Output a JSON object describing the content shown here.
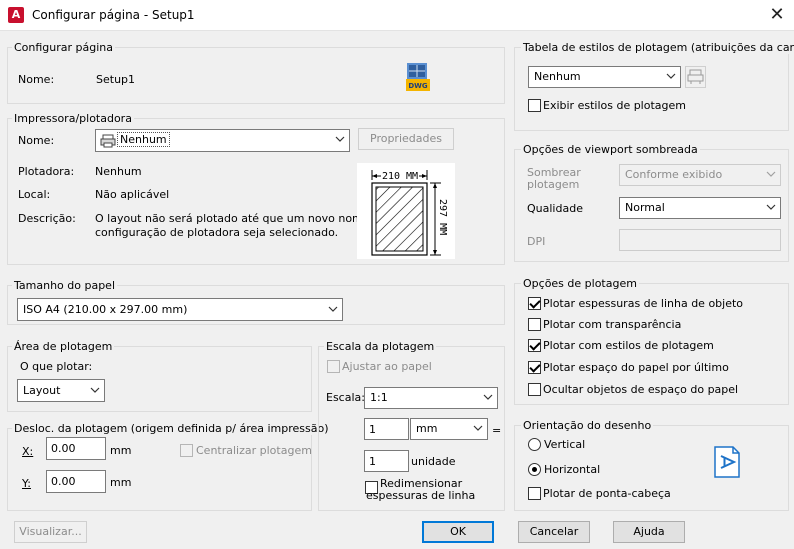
{
  "window": {
    "title": "Configurar página - Setup1",
    "app_icon_letter": "A",
    "close_glyph": "✕"
  },
  "page_setup": {
    "group_title": "Configurar página",
    "name_label": "Nome:",
    "name_value": "Setup1",
    "file_icon_text": "DWG"
  },
  "printer": {
    "group_title": "Impressora/plotadora",
    "name_label": "Nome:",
    "name_value": "Nenhum",
    "properties_button": "Propriedades",
    "plotter_label": "Plotadora:",
    "plotter_value": "Nenhum",
    "location_label": "Local:",
    "location_value": "Não aplicável",
    "description_label": "Descrição:",
    "description_line1": "O layout não será plotado até que um novo nome de",
    "description_line2": "configuração de plotadora seja selecionado.",
    "preview_width": "210 MM",
    "preview_height": "297 MM"
  },
  "paper_size": {
    "group_title": "Tamanho do papel",
    "value": "ISO A4 (210.00 x 297.00 mm)"
  },
  "plot_area": {
    "group_title": "Área de plotagem",
    "what_label": "O que plotar:",
    "what_value": "Layout"
  },
  "plot_offset": {
    "group_title": "Desloc. da plotagem (origem definida p/ área impressão)",
    "x_label": "X:",
    "x_value": "0.00",
    "x_unit": "mm",
    "y_label": "Y:",
    "y_value": "0.00",
    "y_unit": "mm",
    "center_label": "Centralizar plotagem"
  },
  "plot_scale": {
    "group_title": "Escala da plotagem",
    "fit_label": "Ajustar ao papel",
    "scale_label": "Escala:",
    "scale_value": "1:1",
    "value1": "1",
    "unit1": "mm",
    "equals": "=",
    "value2": "1",
    "unit2_label": "unidade",
    "scale_lineweights_line1": "Redimensionar",
    "scale_lineweights_line2": "espessuras de linha"
  },
  "plot_style_table": {
    "group_title": "Tabela de estilos de plotagem (atribuições da caneta)",
    "value": "Nenhum",
    "display_label": "Exibir estilos de plotagem"
  },
  "shaded_viewport": {
    "group_title": "Opções de viewport sombreada",
    "shade_label_line1": "Sombrear",
    "shade_label_line2": "plotagem",
    "shade_value": "Conforme exibido",
    "quality_label": "Qualidade",
    "quality_value": "Normal",
    "dpi_label": "DPI"
  },
  "plot_options": {
    "group_title": "Opções de plotagem",
    "items": [
      {
        "label": "Plotar espessuras de linha de objeto",
        "checked": true
      },
      {
        "label": "Plotar com transparência",
        "checked": false
      },
      {
        "label": "Plotar com estilos de plotagem",
        "checked": true
      },
      {
        "label": "Plotar espaço do papel por último",
        "checked": true
      },
      {
        "label": "Ocultar objetos de espaço do papel",
        "checked": false
      }
    ]
  },
  "orientation": {
    "group_title": "Orientação do desenho",
    "portrait": "Vertical",
    "landscape": "Horizontal",
    "upside_down": "Plotar de ponta-cabeça",
    "selected": "landscape",
    "icon_letter": "A"
  },
  "footer": {
    "preview_button": "Visualizar...",
    "ok_button": "OK",
    "cancel_button": "Cancelar",
    "help_button": "Ajuda"
  },
  "colors": {
    "accent": "#0078d7",
    "brand": "#c8102e",
    "group_border": "#dcdcdc"
  }
}
